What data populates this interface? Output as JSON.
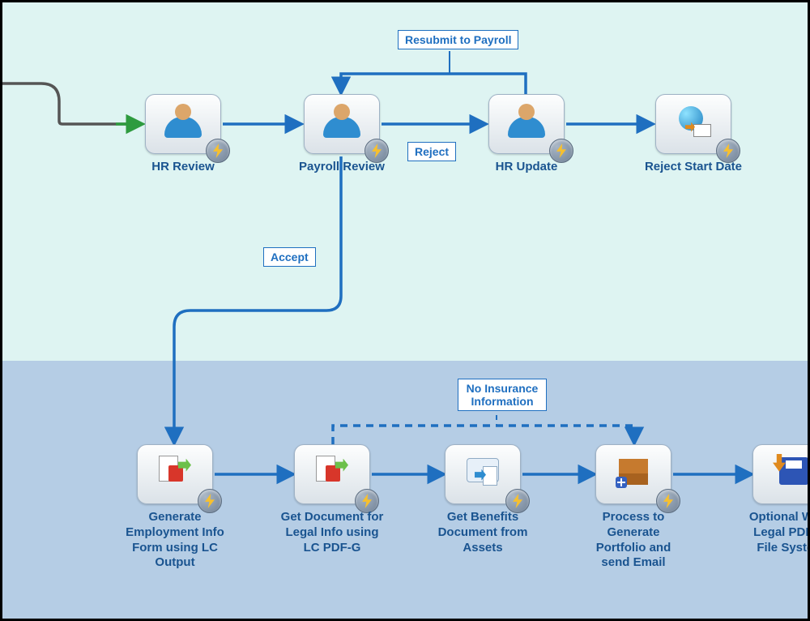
{
  "nodes": {
    "hr_review": {
      "label": "HR Review"
    },
    "payroll_review": {
      "label": "Payroll Review"
    },
    "hr_update": {
      "label": "HR Update"
    },
    "reject_start": {
      "label": "Reject Start Date"
    },
    "gen_employment": {
      "label": "Generate Employment Info Form using LC Output"
    },
    "get_legal": {
      "label": "Get Document for Legal Info using LC PDF-G"
    },
    "get_benefits": {
      "label": "Get Benefits Document from Assets"
    },
    "process_email": {
      "label": "Process to Generate Portfolio and send Email"
    },
    "write_pdf": {
      "label": "Optional Write Legal PDF to File System"
    }
  },
  "edge_labels": {
    "resubmit": "Resubmit to Payroll",
    "reject": "Reject",
    "accept": "Accept",
    "no_insurance": "No Insurance Information"
  }
}
